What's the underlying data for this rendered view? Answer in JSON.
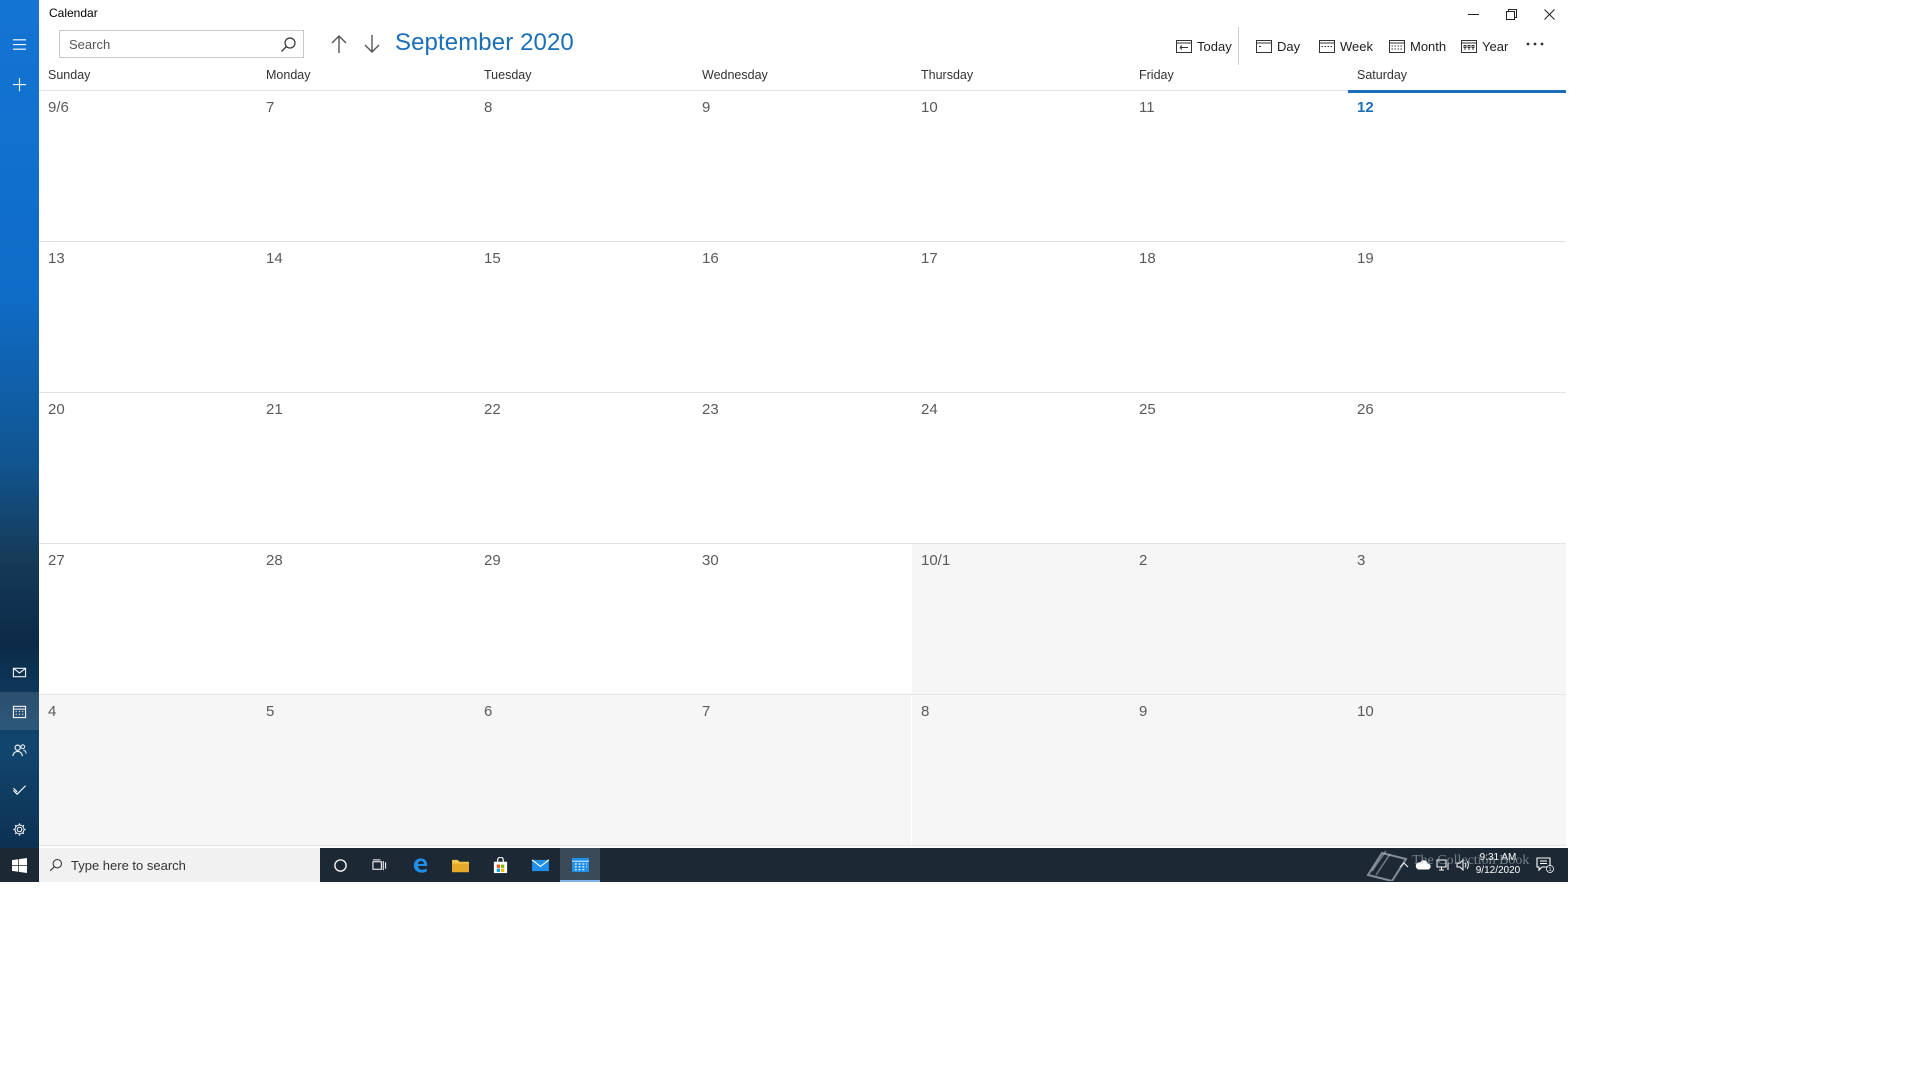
{
  "app": {
    "title": "Calendar"
  },
  "search": {
    "placeholder": "Search",
    "value": ""
  },
  "header": {
    "month_title": "September 2020"
  },
  "views": {
    "today": "Today",
    "day": "Day",
    "week": "Week",
    "month": "Month",
    "year": "Year"
  },
  "weekdays": [
    "Sunday",
    "Monday",
    "Tuesday",
    "Wednesday",
    "Thursday",
    "Friday",
    "Saturday"
  ],
  "weeks": [
    [
      "9/6",
      "7",
      "8",
      "9",
      "10",
      "11",
      "12"
    ],
    [
      "13",
      "14",
      "15",
      "16",
      "17",
      "18",
      "19"
    ],
    [
      "20",
      "21",
      "22",
      "23",
      "24",
      "25",
      "26"
    ],
    [
      "27",
      "28",
      "29",
      "30",
      "10/1",
      "2",
      "3"
    ],
    [
      "4",
      "5",
      "6",
      "7",
      "8",
      "9",
      "10"
    ]
  ],
  "today_label": "12",
  "taskbar": {
    "search_text": "Type here to search",
    "time": "9:31 AM",
    "date": "9/12/2020",
    "notification_count": "1"
  },
  "watermark": {
    "text": "The Collection Book"
  },
  "colors": {
    "accent": "#1b6fb8",
    "rail": "#0f6cc7",
    "taskbar": "#1c2833"
  }
}
